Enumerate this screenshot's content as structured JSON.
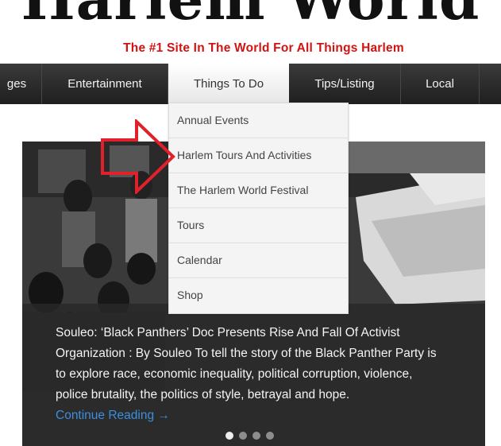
{
  "header": {
    "logo_text": "Harlem World",
    "tagline": "The #1 Site In The World For All Things Harlem"
  },
  "nav": {
    "items": [
      {
        "label": "ges"
      },
      {
        "label": "Entertainment"
      },
      {
        "label": "Things To Do",
        "active": true
      },
      {
        "label": "Tips/Listing"
      },
      {
        "label": "Local"
      }
    ]
  },
  "dropdown": {
    "items": [
      {
        "label": "Annual Events"
      },
      {
        "label": "Harlem Tours And Activities"
      },
      {
        "label": "The Harlem World Festival"
      },
      {
        "label": "Tours"
      },
      {
        "label": "Calendar"
      },
      {
        "label": "Shop"
      }
    ]
  },
  "hero": {
    "caption": "Souleo: ‘Black Panthers’ Doc Presents Rise And Fall Of Activist Organization :   By Souleo To tell the story of the Black Panther Party is to explore race, economic inequality, political corruption, violence, police brutality, the politics of style, betrayal and hope.",
    "continue_label": "Continue Reading →",
    "slides_total": 4,
    "active_slide": 1
  },
  "annotation": {
    "arrow_color": "#e0212b",
    "arrow_icon": "right-arrow-outline-icon"
  },
  "colors": {
    "tagline": "#d31212",
    "nav_bg": "#2b2b2b",
    "link": "#3b8fe0"
  }
}
